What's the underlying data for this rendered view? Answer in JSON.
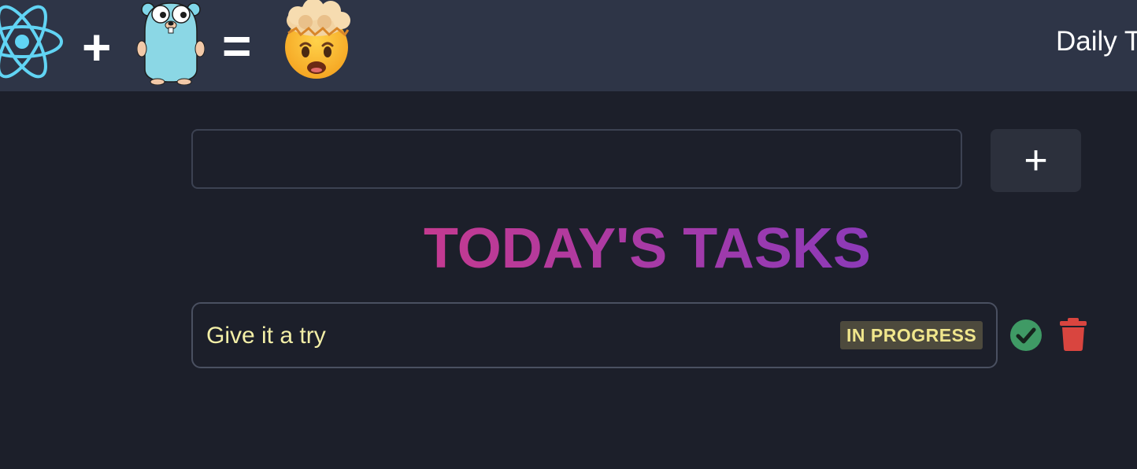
{
  "header": {
    "brand_text": "Daily T",
    "operators": [
      "+",
      "="
    ],
    "logos": [
      "react-logo",
      "gopher-mascot",
      "mind-blown-emoji"
    ]
  },
  "task_input": {
    "value": "",
    "placeholder": ""
  },
  "add_button": {
    "label": "+"
  },
  "heading": "TODAY'S TASKS",
  "tasks": [
    {
      "text": "Give it a try",
      "status": "IN PROGRESS",
      "actions": [
        "check-icon",
        "trash-icon"
      ]
    }
  ],
  "colors": {
    "background": "#1c1f2a",
    "topbar": "#2e3547",
    "heading_start": "#c43a90",
    "heading_end": "#8c3ab8",
    "task_text": "#f3efa7",
    "status_badge_bg": "#4d4a3d",
    "complete": "#3f9a65",
    "delete": "#d9453f"
  }
}
